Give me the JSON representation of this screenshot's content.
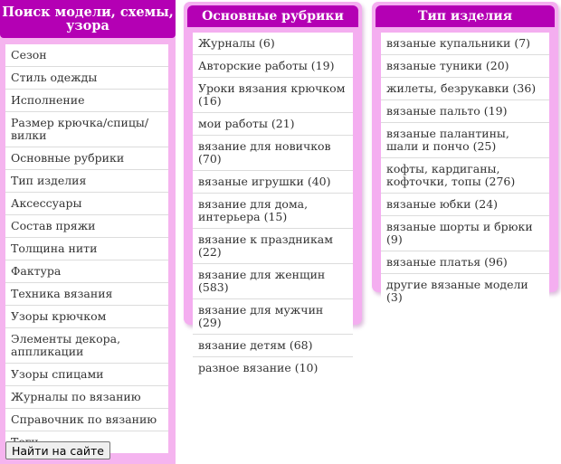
{
  "left_panel": {
    "title": "Поиск модели, схемы, узора",
    "items": [
      "Сезон",
      "Стиль одежды",
      "Исполнение",
      "Размер крючка/спицы/вилки",
      "Основные рубрики",
      "Тип изделия",
      "Аксессуары",
      "Состав пряжи",
      "Толщина нити",
      "Фактура",
      "Техника вязания",
      "Узоры крючком",
      "Элементы декора, аппликации",
      "Узоры спицами",
      "Журналы по вязанию",
      "Справочник по вязанию",
      "Теги"
    ],
    "search_button": "Найти на сайте"
  },
  "rubrics": {
    "title": "Основные рубрики",
    "items": [
      "Журналы (6)",
      "Авторские работы (19)",
      "Уроки вязания крючком (16)",
      "мои работы (21)",
      "вязание для новичков (70)",
      "вязаные игрушки (40)",
      "вязание для дома, интерьера (15)",
      "вязание к праздникам (22)",
      "вязание для женщин (583)",
      "вязание для мужчин (29)",
      "вязание детям (68)",
      "разное вязание (10)"
    ]
  },
  "types": {
    "title": "Тип изделия",
    "items": [
      "вязаные купальники (7)",
      "вязаные туники (20)",
      "жилеты, безрукавки (36)",
      "вязаные пальто (19)",
      "вязаные палантины, шали и пончо (25)",
      "кофты, кардиганы, кофточки, топы (276)",
      "вязаные юбки (24)",
      "вязаные шорты и брюки (9)",
      "вязаные платья (96)",
      "другие вязаные модели (3)"
    ]
  },
  "colors": {
    "header": "#b400b4",
    "panel": "#f4aef0"
  }
}
